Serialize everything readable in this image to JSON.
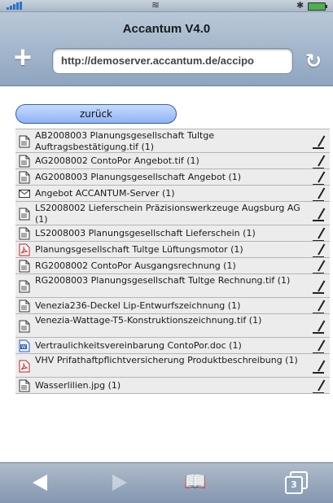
{
  "status": {
    "signal": "signal-icon",
    "wifi": "wifi-icon",
    "bluetooth": "bluetooth-icon",
    "battery": "battery-icon"
  },
  "browser": {
    "title": "Accantum V4.0",
    "url": "http://demoserver.accantum.de/accipo",
    "add_icon": "plus-icon",
    "reload_icon": "reload-icon"
  },
  "page": {
    "back_label": "zurück",
    "documents": [
      {
        "icon": "document-icon",
        "label": "AB2008003 Planungsgesellschaft Tultge Auftragsbestätigung.tif  (1)"
      },
      {
        "icon": "document-icon",
        "label": "AG2008002 ContoPor Angebot.tif  (1)"
      },
      {
        "icon": "document-icon",
        "label": "AG2008003 Planungsgesellschaft Angebot  (1)"
      },
      {
        "icon": "mail-icon",
        "label": "Angebot ACCANTUM-Server  (1)"
      },
      {
        "icon": "document-icon",
        "label": "LS2008002 Lieferschein Präzisionswerkzeuge Augsburg AG  (1)"
      },
      {
        "icon": "document-icon",
        "label": "LS2008003 Planungsgesellschaft Lieferschein  (1)"
      },
      {
        "icon": "pdf-icon",
        "label": "Planungsgesellschaft Tultge Lüftungsmotor  (1)"
      },
      {
        "icon": "document-icon",
        "label": "RG2008002 ContoPor Ausgangsrechnung  (1)"
      },
      {
        "icon": "document-icon",
        "label": "RG2008003 Planungsgesellschaft Tultge Rechnung.tif  (1)"
      },
      {
        "icon": "document-icon",
        "label": "Venezia236-Deckel Lip-Entwurfszeichnung  (1)"
      },
      {
        "icon": "document-icon",
        "label": "Venezia-Wattage-T5-Konstruktionszeichnung.tif  (1)"
      },
      {
        "icon": "word-icon",
        "label": "Vertraulichkeitsvereinbarung ContoPor.doc  (1)"
      },
      {
        "icon": "pdf-icon",
        "label": "VHV Prifathaftpflichtversicherung Produktbeschreibung  (1)"
      },
      {
        "icon": "document-icon",
        "label": "Wasserlilien.jpg  (1)"
      }
    ]
  },
  "toolbar": {
    "back": "back-arrow-icon",
    "forward": "forward-arrow-icon",
    "bookmarks": "bookmarks-icon",
    "pages": "pages-icon",
    "pages_count": "3"
  }
}
